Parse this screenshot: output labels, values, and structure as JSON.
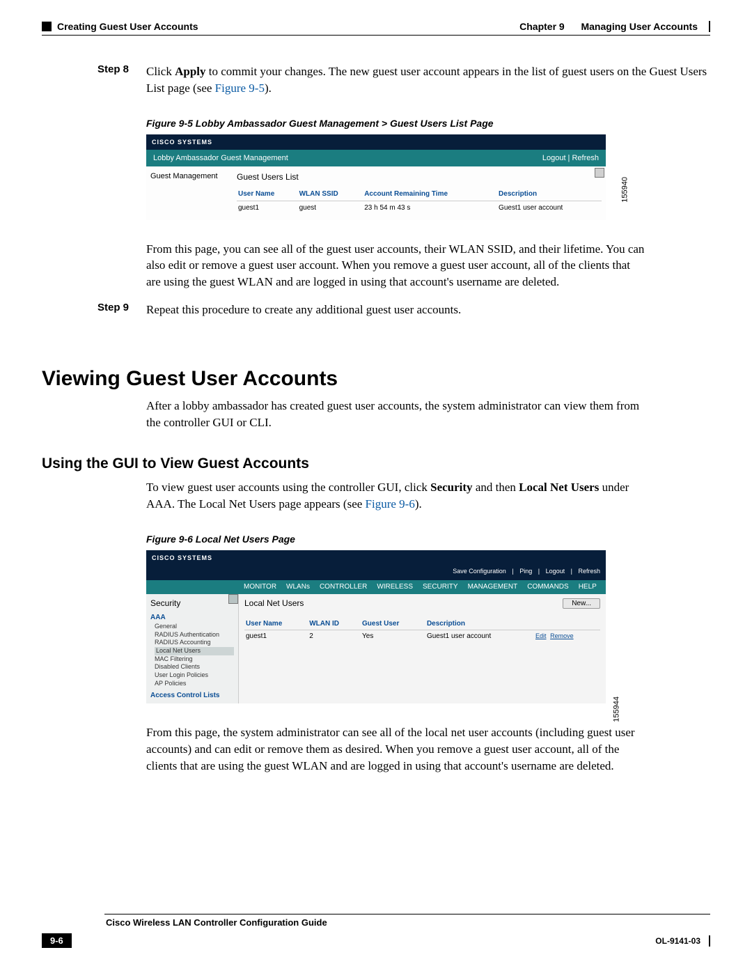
{
  "header": {
    "left": "Creating Guest User Accounts",
    "right_chapter": "Chapter 9",
    "right_title": "Managing User Accounts"
  },
  "step8": {
    "label": "Step 8",
    "text_a": "Click ",
    "apply": "Apply",
    "text_b": " to commit your changes. The new guest user account appears in the list of guest users on the Guest Users List page (see ",
    "figlink": "Figure 9-5",
    "text_c": ")."
  },
  "fig1": {
    "caption": "Figure 9-5     Lobby Ambassador Guest Management > Guest Users List Page",
    "logo": "Cisco Systems",
    "bar_left": "Lobby Ambassador Guest Management",
    "bar_right": "Logout | Refresh",
    "leftnav": "Guest Management",
    "title": "Guest Users List",
    "cols": {
      "user": "User Name",
      "ssid": "WLAN SSID",
      "time": "Account Remaining Time",
      "desc": "Description"
    },
    "row": {
      "user": "guest1",
      "ssid": "guest",
      "time": "23 h 54 m 43 s",
      "desc": "Guest1 user account"
    },
    "sidecode": "155940"
  },
  "para1": "From this page, you can see all of the guest user accounts, their WLAN SSID, and their lifetime. You can also edit or remove a guest user account. When you remove a guest user account, all of the clients that are using the guest WLAN and are logged in using that account's username are deleted.",
  "step9": {
    "label": "Step 9",
    "text": "Repeat this procedure to create any additional guest user accounts."
  },
  "h1": "Viewing Guest User Accounts",
  "para2": "After a lobby ambassador has created guest user accounts, the system administrator can view them from the controller GUI or CLI.",
  "h2": "Using the GUI to View Guest Accounts",
  "para3_a": "To view guest user accounts using the controller GUI, click ",
  "para3_sec": "Security",
  "para3_b": " and then ",
  "para3_lnu": "Local Net Users",
  "para3_c": " under AAA. The Local Net Users page appears (see ",
  "para3_link": "Figure 9-6",
  "para3_d": ").",
  "fig2": {
    "caption": "Figure 9-6     Local Net Users Page",
    "logo": "Cisco Systems",
    "actions": {
      "save": "Save Configuration",
      "ping": "Ping",
      "logout": "Logout",
      "refresh": "Refresh"
    },
    "menu": [
      "MONITOR",
      "WLANs",
      "CONTROLLER",
      "WIRELESS",
      "SECURITY",
      "MANAGEMENT",
      "COMMANDS",
      "HELP"
    ],
    "left": {
      "title": "Security",
      "aaa": "AAA",
      "items": [
        "General",
        "RADIUS Authentication",
        "RADIUS Accounting",
        "Local Net Users",
        "MAC Filtering",
        "Disabled Clients",
        "User Login Policies",
        "AP Policies"
      ],
      "acl": "Access Control Lists"
    },
    "page_title": "Local Net Users",
    "new_btn": "New...",
    "cols": {
      "user": "User Name",
      "wlan": "WLAN ID",
      "guest": "Guest User",
      "desc": "Description"
    },
    "row": {
      "user": "guest1",
      "wlan": "2",
      "guest": "Yes",
      "desc": "Guest1 user account",
      "edit": "Edit",
      "remove": "Remove"
    },
    "sidecode": "155944"
  },
  "para4": "From this page, the system administrator can see all of the local net user accounts (including guest user accounts) and can edit or remove them as desired. When you remove a guest user account, all of the clients that are using the guest WLAN and are logged in using that account's username are deleted.",
  "footer": {
    "doc_title": "Cisco Wireless LAN Controller Configuration Guide",
    "page_num": "9-6",
    "ol": "OL-9141-03"
  }
}
